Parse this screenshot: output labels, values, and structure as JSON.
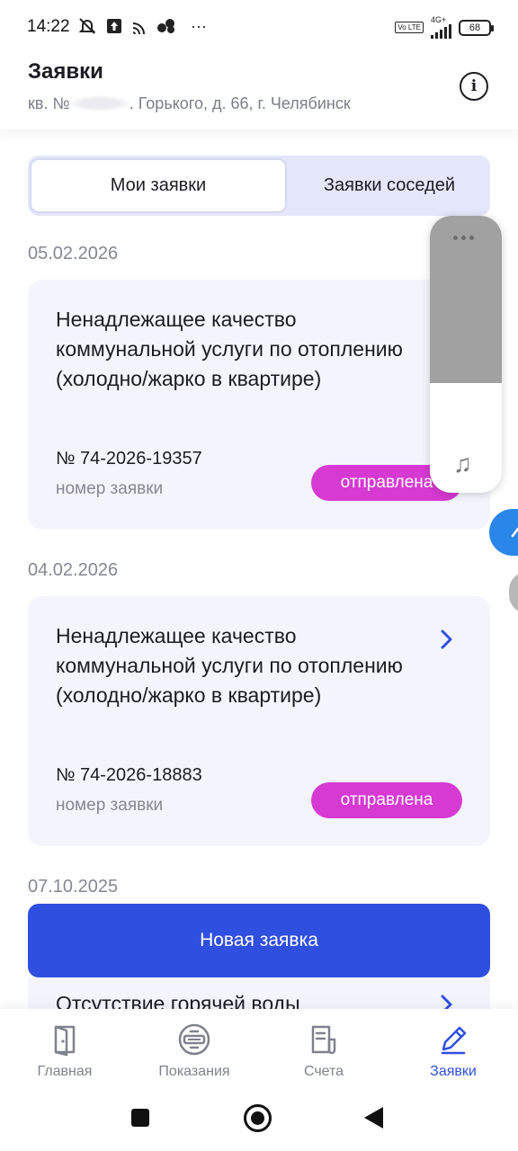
{
  "status_bar": {
    "time": "14:22",
    "network": "4G+",
    "volte": "Vo LTE",
    "battery": "68",
    "more": "···"
  },
  "header": {
    "title": "Заявки",
    "address_prefix": "кв. №",
    "address_rest": ". Горького, д. 66, г. Челябинск",
    "info_glyph": "i"
  },
  "tabs": [
    {
      "label": "Мои заявки",
      "active": true
    },
    {
      "label": "Заявки соседей",
      "active": false
    }
  ],
  "requests": [
    {
      "date": "05.02.2026",
      "title": "Ненадлежащее качество коммунальной услуги по отоплению (холодно/жарко в квартире)",
      "number": "№ 74-2026-19357",
      "number_label": "номер заявки",
      "status": "отправлена"
    },
    {
      "date": "04.02.2026",
      "title": "Ненадлежащее качество коммунальной услуги по отоплению (холодно/жарко в квартире)",
      "number": "№ 74-2026-18883",
      "number_label": "номер заявки",
      "status": "отправлена"
    },
    {
      "date": "07.10.2025",
      "title": "Отсутствие горячей воды"
    }
  ],
  "new_request_button": "Новая заявка",
  "media_widget": {
    "note_glyph": "♫"
  },
  "bottom_nav": [
    {
      "label": "Главная",
      "icon": "door-icon",
      "active": false
    },
    {
      "label": "Показания",
      "icon": "meter-icon",
      "active": false
    },
    {
      "label": "Счета",
      "icon": "receipt-icon",
      "active": false
    },
    {
      "label": "Заявки",
      "icon": "pencil-icon",
      "active": true
    }
  ],
  "colors": {
    "accent": "#2f4fe0",
    "status_badge": "#d63ad3",
    "card_bg": "#f4f5fc",
    "segment_bg": "#e4e6fb"
  }
}
